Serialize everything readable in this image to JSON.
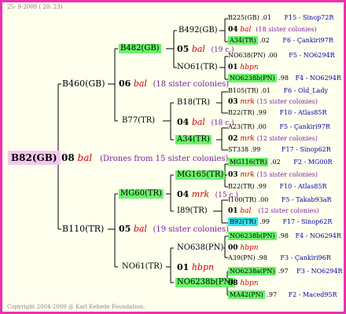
{
  "header": "25-  9-2009 ( 20: 23)",
  "footer": "Copyright 2004-2009 @ Karl Kehede Foundation.",
  "root": {
    "label": "B82(GB)",
    "gen": "08",
    "race": "bal",
    "note": "(Drones from 15 sister colonies)"
  },
  "queen_top": {
    "label": "B460(GB)",
    "gen": "06",
    "race": "bal",
    "note": "(18 sister colonies)"
  },
  "queen_bottom": {
    "label": "B110(TR)",
    "gen": "05",
    "race": "bal",
    "note": "(19 sister colonies)"
  },
  "g2": {
    "b482": {
      "label": "B482(GB)",
      "gen": "05",
      "race": "bal",
      "note": "(19 c.)"
    },
    "no61a": {
      "label": "NO61(TR)"
    },
    "b77": {
      "label": "B77(TR)",
      "gen": "04",
      "race": "bal",
      "note": "(18 c.)"
    },
    "mg60": {
      "label": "MG60(TR)",
      "gen": "04",
      "race": "mrk",
      "note": "(15 c.)"
    },
    "no61b": {
      "label": "NO61(TR)",
      "gen": "01",
      "race": "hbpn"
    }
  },
  "g3": {
    "b492": {
      "label": "B492(GB)"
    },
    "b18": {
      "label": "B18(TR)"
    },
    "a34": {
      "label": "A34(TR)"
    },
    "mg165": {
      "label": "MG165(TR)",
      "gen": "04",
      "race": "mrk",
      "note": "(15 c.)"
    },
    "i89": {
      "label": "I89(TR)"
    },
    "no638": {
      "label": "NO638(PN)"
    },
    "no6238b": {
      "label": "NO6238b(PN)",
      "gen": "98",
      "race": "hbpn"
    }
  },
  "g4": [
    {
      "label": "B225(GB)",
      "score": ".01",
      "ref": "F15 - Sinop72R"
    },
    {
      "gen": "04",
      "race": "bal",
      "note": "(18 sister colonies)"
    },
    {
      "label": "A34(TR)",
      "score": ".02",
      "ref": "F6 - Çankiri97R"
    },
    {
      "label": "NO638(PN)",
      "score": ".00",
      "ref": "F5 - NO6294R"
    },
    {
      "gen": "01",
      "race": "hbpn"
    },
    {
      "label": "NO6238b(PN)",
      "score": ".98",
      "ref": "F4 - NO6294R"
    },
    {
      "label": "B105(TR)",
      "score": ".01",
      "ref": "F6 - Old_Lady"
    },
    {
      "gen": "03",
      "race": "mrk",
      "note": "(15 sister colonies)"
    },
    {
      "label": "B22(TR)",
      "score": ".99",
      "ref": "F10 - Atlas85R"
    },
    {
      "label": "A23(TR)",
      "score": ".00",
      "ref": "F5 - Çankiri97R"
    },
    {
      "gen": "02",
      "race": "mrk",
      "note": "(12 sister colonies)"
    },
    {
      "label": "ST338",
      "score": ".99",
      "ref": "F17 - Sinop62R"
    },
    {
      "label": "MG116(TR)",
      "score": ".02",
      "ref": "F2 - MG00R"
    },
    {
      "gen": "03",
      "race": "mrk",
      "note": "(15 sister colonies)"
    },
    {
      "label": "B22(TR)",
      "score": ".99",
      "ref": "F10 - Atlas85R"
    },
    {
      "label": "I100(TR)",
      "score": ".00",
      "ref": "F5 - Takab93aR"
    },
    {
      "gen": "01",
      "race": "bal",
      "note": "(12 sister colonies)"
    },
    {
      "label": "B92(TR)",
      "score": ".99",
      "ref": "F17 - Sinop62R"
    },
    {
      "label": "NO6238b(PN)",
      "score": ".98",
      "ref": "F4 - NO6294R"
    },
    {
      "gen": "00",
      "race": "hbpn"
    },
    {
      "label": "A39(PN)",
      "score": ".98",
      "ref": "F3 - Çankiri96R"
    },
    {
      "label": "NO6238a(PN)",
      "score": ".97",
      "ref": "F3 - NO6294R"
    },
    {
      "gen": "98",
      "race": "hbpn"
    },
    {
      "label": "MA42(PN)",
      "score": ".97",
      "ref": "F2 - Maced95R"
    }
  ],
  "colors": {
    "border": "#ee2fb2",
    "background": "#ffffee",
    "green": "#6cf26c",
    "cyan": "#33e3ee",
    "root_bg": "#f4c8ec",
    "race": "#d00000",
    "note": "#7a1ea0",
    "ref": "#0000aa"
  }
}
